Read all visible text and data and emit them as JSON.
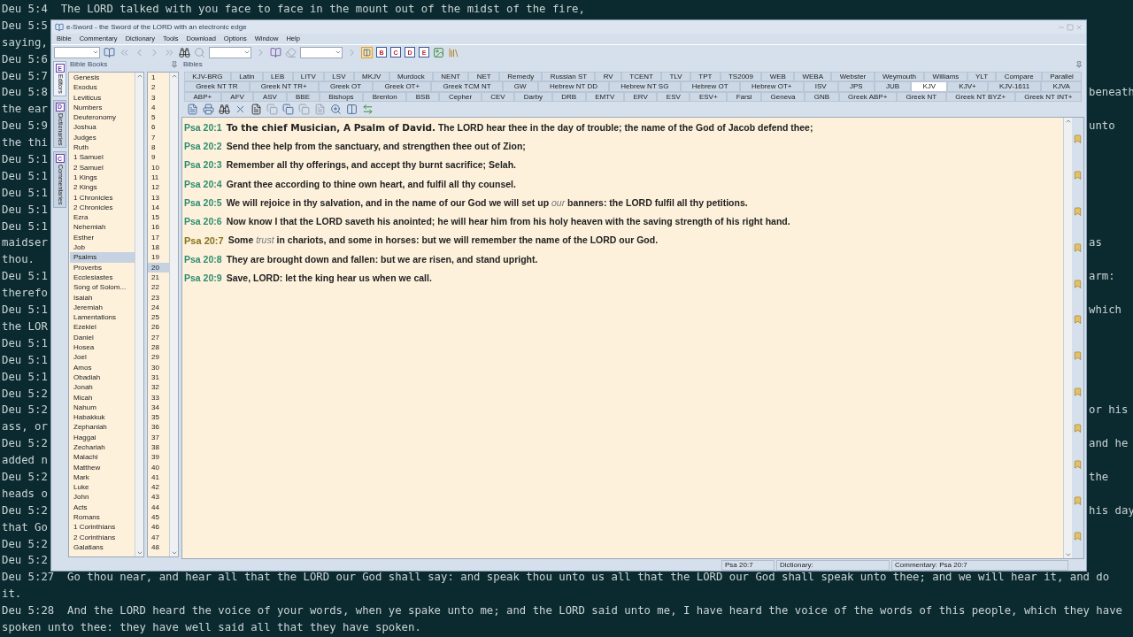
{
  "terminal": {
    "lines": [
      {
        "text": "Deu 5:4  The LORD talked with you face to face in the mount out of the midst of the fire,"
      },
      {
        "left": "Deu 5:5"
      },
      {
        "left": "saying,"
      },
      {
        "left": "Deu 5:6"
      },
      {
        "left": "Deu 5:7"
      },
      {
        "left": "Deu 5:8",
        "right": "beneath"
      },
      {
        "left": "the ear"
      },
      {
        "left": "Deu 5:9",
        "right": "unto"
      },
      {
        "left": "the thi"
      },
      {
        "left": "Deu 5:1"
      },
      {
        "left": "Deu 5:1"
      },
      {
        "left": "Deu 5:1"
      },
      {
        "left": "Deu 5:1"
      },
      {
        "left": "Deu 5:1"
      },
      {
        "left": "maidser",
        "right": "as"
      },
      {
        "left": "thou."
      },
      {
        "left": "Deu 5:1",
        "right": "arm:"
      },
      {
        "left": "therefo"
      },
      {
        "left": "Deu 5:1",
        "right": "which"
      },
      {
        "left": "the LOR"
      },
      {
        "left": "Deu 5:1"
      },
      {
        "left": "Deu 5:1"
      },
      {
        "left": "Deu 5:1"
      },
      {
        "left": "Deu 5:2"
      },
      {
        "left": "Deu 5:2",
        "right": "or his"
      },
      {
        "left": "ass, or"
      },
      {
        "left": "Deu 5:2",
        "right": "and he"
      },
      {
        "left": "added n"
      },
      {
        "left": "Deu 5:2",
        "right": "the"
      },
      {
        "left": "heads o"
      },
      {
        "left": "Deu 5:2",
        "right": "his day"
      },
      {
        "left": "that Go"
      },
      {
        "left": "Deu 5:2"
      },
      {
        "left": "Deu 5:2"
      },
      {
        "text": "Deu 5:27  Go thou near, and hear all that the LORD our God shall say: and speak thou unto us all that the LORD our God shall speak unto thee; and we will hear it, and do"
      },
      {
        "text": "it."
      },
      {
        "text": "Deu 5:28  And the LORD heard the voice of your words, when ye spake unto me; and the LORD said unto me, I have heard the voice of the words of this people, which they have"
      },
      {
        "text": "spoken unto thee: they have well said all that they have spoken."
      }
    ]
  },
  "window": {
    "title": "e-Sword - the Sword of the LORD with an electronic edge",
    "menu": [
      "Bible",
      "Commentary",
      "Dictionary",
      "Tools",
      "Download",
      "Options",
      "Window",
      "Help"
    ],
    "toolbar_letters": [
      "B",
      "C",
      "D",
      "E"
    ],
    "side_tabs": [
      {
        "letter": "E",
        "label": "Editors",
        "selected": true
      },
      {
        "letter": "D",
        "label": "Dictionaries",
        "selected": false
      },
      {
        "letter": "C",
        "label": "Commentaries",
        "selected": false
      }
    ],
    "books_panel": {
      "title": "Bible Books",
      "books": [
        {
          "name": "Genesis",
          "selected": false
        },
        {
          "name": "Exodus",
          "selected": false
        },
        {
          "name": "Leviticus",
          "selected": false
        },
        {
          "name": "Numbers",
          "selected": false
        },
        {
          "name": "Deuteronomy",
          "selected": false
        },
        {
          "name": "Joshua",
          "selected": false
        },
        {
          "name": "Judges",
          "selected": false
        },
        {
          "name": "Ruth",
          "selected": false
        },
        {
          "name": "1 Samuel",
          "selected": false
        },
        {
          "name": "2 Samuel",
          "selected": false
        },
        {
          "name": "1 Kings",
          "selected": false
        },
        {
          "name": "2 Kings",
          "selected": false
        },
        {
          "name": "1 Chronicles",
          "selected": false
        },
        {
          "name": "2 Chronicles",
          "selected": false
        },
        {
          "name": "Ezra",
          "selected": false
        },
        {
          "name": "Nehemiah",
          "selected": false
        },
        {
          "name": "Esther",
          "selected": false
        },
        {
          "name": "Job",
          "selected": false
        },
        {
          "name": "Psalms",
          "selected": true
        },
        {
          "name": "Proverbs",
          "selected": false
        },
        {
          "name": "Ecclesiastes",
          "selected": false
        },
        {
          "name": "Song of Solom...",
          "selected": false
        },
        {
          "name": "Isaiah",
          "selected": false
        },
        {
          "name": "Jeremiah",
          "selected": false
        },
        {
          "name": "Lamentations",
          "selected": false
        },
        {
          "name": "Ezekiel",
          "selected": false
        },
        {
          "name": "Daniel",
          "selected": false
        },
        {
          "name": "Hosea",
          "selected": false
        },
        {
          "name": "Joel",
          "selected": false
        },
        {
          "name": "Amos",
          "selected": false
        },
        {
          "name": "Obadiah",
          "selected": false
        },
        {
          "name": "Jonah",
          "selected": false
        },
        {
          "name": "Micah",
          "selected": false
        },
        {
          "name": "Nahum",
          "selected": false
        },
        {
          "name": "Habakkuk",
          "selected": false
        },
        {
          "name": "Zephaniah",
          "selected": false
        },
        {
          "name": "Haggai",
          "selected": false
        },
        {
          "name": "Zechariah",
          "selected": false
        },
        {
          "name": "Malachi",
          "selected": false
        },
        {
          "name": "Matthew",
          "selected": false
        },
        {
          "name": "Mark",
          "selected": false
        },
        {
          "name": "Luke",
          "selected": false
        },
        {
          "name": "John",
          "selected": false
        },
        {
          "name": "Acts",
          "selected": false
        },
        {
          "name": "Romans",
          "selected": false
        },
        {
          "name": "1 Corinthians",
          "selected": false
        },
        {
          "name": "2 Corinthians",
          "selected": false
        },
        {
          "name": "Galatians",
          "selected": false
        }
      ],
      "chapters": [
        {
          "number": "1",
          "selected": false
        },
        {
          "number": "2",
          "selected": false
        },
        {
          "number": "3",
          "selected": false
        },
        {
          "number": "4",
          "selected": false
        },
        {
          "number": "5",
          "selected": false
        },
        {
          "number": "6",
          "selected": false
        },
        {
          "number": "7",
          "selected": false
        },
        {
          "number": "8",
          "selected": false
        },
        {
          "number": "9",
          "selected": false
        },
        {
          "number": "10",
          "selected": false
        },
        {
          "number": "11",
          "selected": false
        },
        {
          "number": "12",
          "selected": false
        },
        {
          "number": "13",
          "selected": false
        },
        {
          "number": "14",
          "selected": false
        },
        {
          "number": "15",
          "selected": false
        },
        {
          "number": "16",
          "selected": false
        },
        {
          "number": "17",
          "selected": false
        },
        {
          "number": "18",
          "selected": false
        },
        {
          "number": "19",
          "selected": false
        },
        {
          "number": "20",
          "selected": true
        },
        {
          "number": "21",
          "selected": false
        },
        {
          "number": "22",
          "selected": false
        },
        {
          "number": "23",
          "selected": false
        },
        {
          "number": "24",
          "selected": false
        },
        {
          "number": "25",
          "selected": false
        },
        {
          "number": "26",
          "selected": false
        },
        {
          "number": "27",
          "selected": false
        },
        {
          "number": "28",
          "selected": false
        },
        {
          "number": "29",
          "selected": false
        },
        {
          "number": "30",
          "selected": false
        },
        {
          "number": "31",
          "selected": false
        },
        {
          "number": "32",
          "selected": false
        },
        {
          "number": "33",
          "selected": false
        },
        {
          "number": "34",
          "selected": false
        },
        {
          "number": "35",
          "selected": false
        },
        {
          "number": "36",
          "selected": false
        },
        {
          "number": "37",
          "selected": false
        },
        {
          "number": "38",
          "selected": false
        },
        {
          "number": "39",
          "selected": false
        },
        {
          "number": "40",
          "selected": false
        },
        {
          "number": "41",
          "selected": false
        },
        {
          "number": "42",
          "selected": false
        },
        {
          "number": "43",
          "selected": false
        },
        {
          "number": "44",
          "selected": false
        },
        {
          "number": "45",
          "selected": false
        },
        {
          "number": "46",
          "selected": false
        },
        {
          "number": "47",
          "selected": false
        },
        {
          "number": "48",
          "selected": false
        }
      ]
    },
    "bibles_panel": {
      "title": "Bibles",
      "tab_rows": [
        [
          {
            "label": "KJV-BRG",
            "selected": false
          },
          {
            "label": "Latin",
            "selected": false
          },
          {
            "label": "LEB",
            "selected": false
          },
          {
            "label": "LITV",
            "selected": false
          },
          {
            "label": "LSV",
            "selected": false
          },
          {
            "label": "MKJV",
            "selected": false
          },
          {
            "label": "Murdock",
            "selected": false
          },
          {
            "label": "NENT",
            "selected": false
          },
          {
            "label": "NET",
            "selected": false
          },
          {
            "label": "Remedy",
            "selected": false
          },
          {
            "label": "Russian ST",
            "selected": false
          },
          {
            "label": "RV",
            "selected": false
          },
          {
            "label": "TCENT",
            "selected": false
          },
          {
            "label": "TLV",
            "selected": false
          },
          {
            "label": "TPT",
            "selected": false
          },
          {
            "label": "TS2009",
            "selected": false
          },
          {
            "label": "WEB",
            "selected": false
          },
          {
            "label": "WEBA",
            "selected": false
          },
          {
            "label": "Webster",
            "selected": false
          },
          {
            "label": "Weymouth",
            "selected": false
          },
          {
            "label": "Williams",
            "selected": false
          },
          {
            "label": "YLT",
            "selected": false
          },
          {
            "label": "Compare",
            "selected": false
          },
          {
            "label": "Parallel",
            "selected": false
          }
        ],
        [
          {
            "label": "Greek NT TR",
            "selected": false
          },
          {
            "label": "Greek NT TR+",
            "selected": false
          },
          {
            "label": "Greek OT",
            "selected": false
          },
          {
            "label": "Greek OT+",
            "selected": false
          },
          {
            "label": "Greek TCM NT",
            "selected": false
          },
          {
            "label": "GW",
            "selected": false
          },
          {
            "label": "Hebrew NT DD",
            "selected": false
          },
          {
            "label": "Hebrew NT SG",
            "selected": false
          },
          {
            "label": "Hebrew OT",
            "selected": false
          },
          {
            "label": "Hebrew OT+",
            "selected": false
          },
          {
            "label": "ISV",
            "selected": false
          },
          {
            "label": "JPS",
            "selected": false
          },
          {
            "label": "JUB",
            "selected": false
          },
          {
            "label": "KJV",
            "selected": true
          },
          {
            "label": "KJV+",
            "selected": false
          },
          {
            "label": "KJV-1611",
            "selected": false
          },
          {
            "label": "KJVA",
            "selected": false
          }
        ],
        [
          {
            "label": "ABP+",
            "selected": false
          },
          {
            "label": "AFV",
            "selected": false
          },
          {
            "label": "ASV",
            "selected": false
          },
          {
            "label": "BBE",
            "selected": false
          },
          {
            "label": "Bishops",
            "selected": false
          },
          {
            "label": "Brenton",
            "selected": false
          },
          {
            "label": "BSB",
            "selected": false
          },
          {
            "label": "Cepher",
            "selected": false
          },
          {
            "label": "CEV",
            "selected": false
          },
          {
            "label": "Darby",
            "selected": false
          },
          {
            "label": "DRB",
            "selected": false
          },
          {
            "label": "EMTV",
            "selected": false
          },
          {
            "label": "ERV",
            "selected": false
          },
          {
            "label": "ESV",
            "selected": false
          },
          {
            "label": "ESV+",
            "selected": false
          },
          {
            "label": "Farsi",
            "selected": false
          },
          {
            "label": "Geneva",
            "selected": false
          },
          {
            "label": "GNB",
            "selected": false
          },
          {
            "label": "Greek ABP+",
            "selected": false
          },
          {
            "label": "Greek NT",
            "selected": false
          },
          {
            "label": "Greek NT BYZ+",
            "selected": false
          },
          {
            "label": "Greek NT INT+",
            "selected": false
          }
        ]
      ],
      "verses": [
        {
          "ref": "Psa 20:1",
          "text": "**To the chief Musician, A Psalm of David.** The LORD hear thee in the day of trouble; the name of the God of Jacob defend thee;",
          "selected": false
        },
        {
          "ref": "Psa 20:2",
          "text": "Send thee help from the sanctuary, and strengthen thee out of Zion;",
          "selected": false
        },
        {
          "ref": "Psa 20:3",
          "text": "Remember all thy offerings, and accept thy burnt sacrifice; Selah.",
          "selected": false
        },
        {
          "ref": "Psa 20:4",
          "text": "Grant thee according to thine own heart, and fulfil all thy counsel.",
          "selected": false
        },
        {
          "ref": "Psa 20:5",
          "text": "We will rejoice in thy salvation, and in the name of our God we will set up *our* banners: the LORD fulfil all thy petitions.",
          "selected": false
        },
        {
          "ref": "Psa 20:6",
          "text": "Now know I that the LORD saveth his anointed; he will hear him from his holy heaven with the saving strength of his right hand.",
          "selected": false
        },
        {
          "ref": "Psa 20:7",
          "text": "Some *trust* in chariots, and some in horses: but we will remember the name of the LORD our God.",
          "selected": true
        },
        {
          "ref": "Psa 20:8",
          "text": "They are brought down and fallen: but we are risen, and stand upright.",
          "selected": false
        },
        {
          "ref": "Psa 20:9",
          "text": "Save, LORD: let the king hear us when we call.",
          "selected": false
        }
      ]
    },
    "status_bar": {
      "verse": "Psa 20:7",
      "dictionary": "Dictionary:",
      "commentary": "Commentary: Psa 20:7"
    }
  }
}
